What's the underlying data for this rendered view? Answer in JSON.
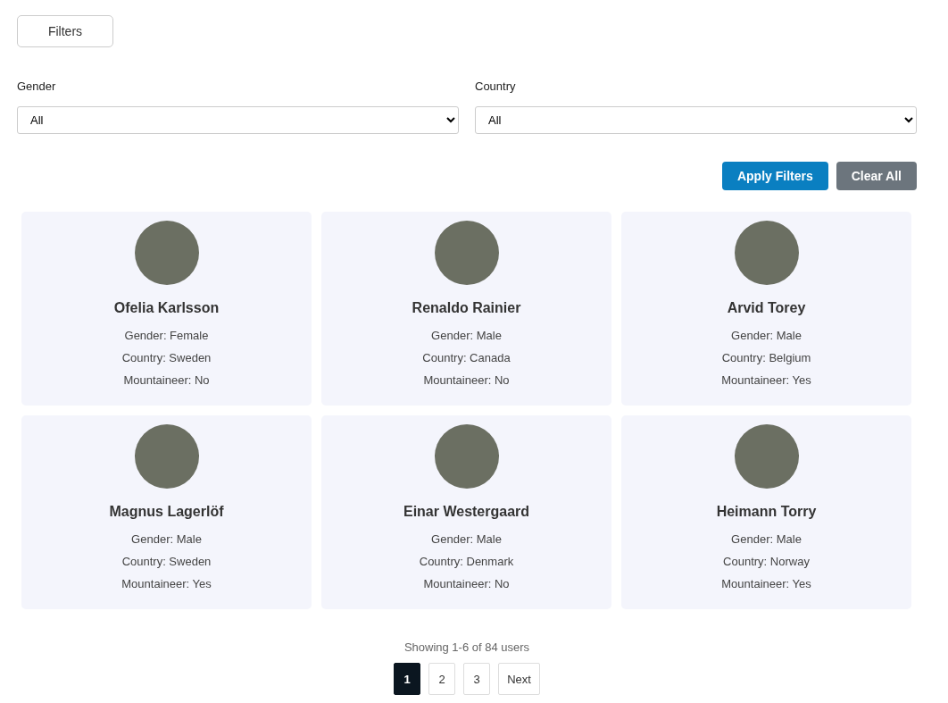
{
  "filters_button": {
    "label": "Filters"
  },
  "fields": [
    {
      "label": "Gender",
      "value": "All"
    },
    {
      "label": "Country",
      "value": "All"
    }
  ],
  "actions": [
    {
      "label": "Apply Filters",
      "kind": "primary"
    },
    {
      "label": "Clear All",
      "kind": "secondary"
    }
  ],
  "users": [
    {
      "name": "Ofelia Karlsson",
      "gender": "Gender: Female",
      "country": "Country: Sweden",
      "mountaineer": "Mountaineer: No"
    },
    {
      "name": "Renaldo Rainier",
      "gender": "Gender: Male",
      "country": "Country: Canada",
      "mountaineer": "Mountaineer: No"
    },
    {
      "name": "Arvid Torey",
      "gender": "Gender: Male",
      "country": "Country: Belgium",
      "mountaineer": "Mountaineer: Yes"
    },
    {
      "name": "Magnus Lagerlöf",
      "gender": "Gender: Male",
      "country": "Country: Sweden",
      "mountaineer": "Mountaineer: Yes"
    },
    {
      "name": "Einar Westergaard",
      "gender": "Gender: Male",
      "country": "Country: Denmark",
      "mountaineer": "Mountaineer: No"
    },
    {
      "name": "Heimann Torry",
      "gender": "Gender: Male",
      "country": "Country: Norway",
      "mountaineer": "Mountaineer: Yes"
    }
  ],
  "summary": "Showing 1-6 of 84 users",
  "pages": [
    {
      "label": "1",
      "selected": true
    },
    {
      "label": "2",
      "selected": false
    },
    {
      "label": "3",
      "selected": false
    },
    {
      "label": "Next",
      "selected": false
    }
  ]
}
